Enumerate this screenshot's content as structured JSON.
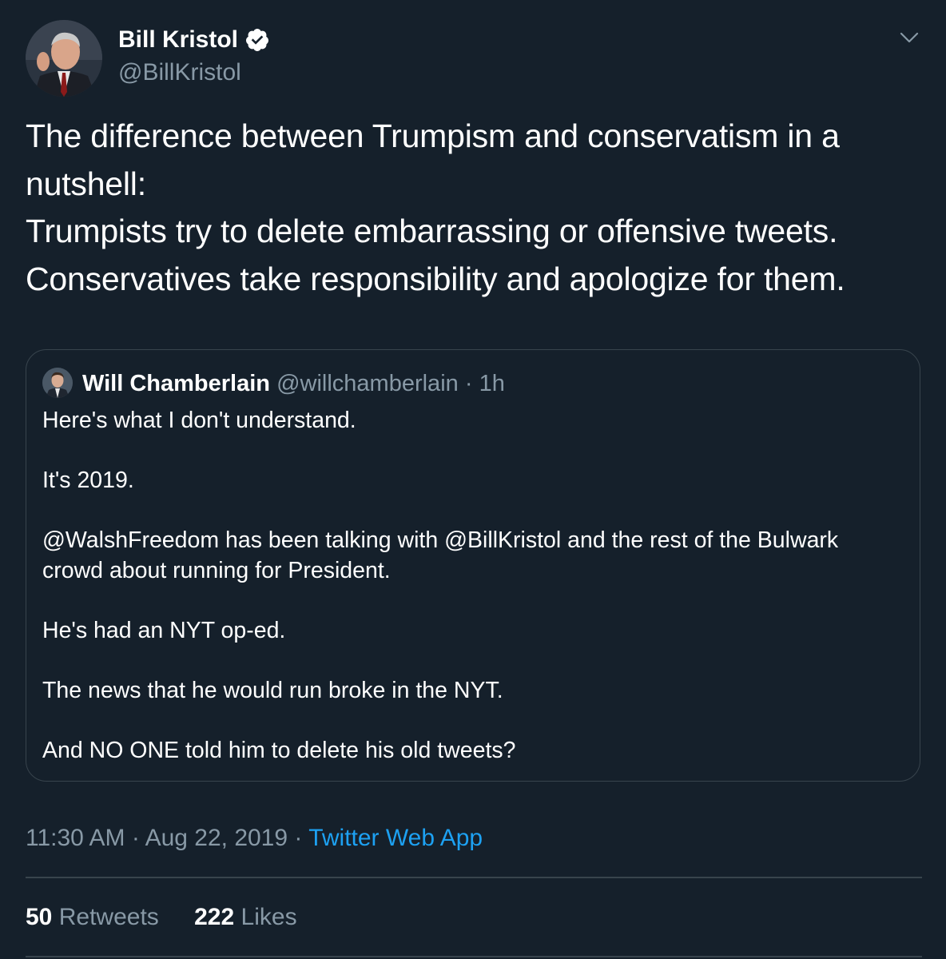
{
  "author": {
    "name": "Bill Kristol",
    "handle": "@BillKristol"
  },
  "tweet": {
    "text": "The difference between Trumpism and conservatism in a\nnutshell:\nTrumpists try to delete embarrassing or offensive tweets.\nConservatives take responsibility and apologize for them."
  },
  "quoted": {
    "name": "Will Chamberlain",
    "handle": "@willchamberlain",
    "separator": "·",
    "time": "1h",
    "text": "Here's what I don't understand.\n\nIt's 2019.\n\n@WalshFreedom has been talking with @BillKristol and the rest of the Bulwark\ncrowd about running for President.\n\nHe's had an NYT op-ed.\n\nThe news that he would run broke in the NYT.\n\nAnd NO ONE told him to delete his old tweets?"
  },
  "meta": {
    "time": "11:30 AM",
    "separator": "·",
    "date": "Aug 22, 2019",
    "source": "Twitter Web App"
  },
  "stats": {
    "retweets_count": "50",
    "retweets_label": "Retweets",
    "likes_count": "222",
    "likes_label": "Likes"
  },
  "icons": {
    "verified": "verified-badge-icon",
    "caret": "chevron-down-icon"
  },
  "colors": {
    "background": "#15202b",
    "secondary_text": "#8899a6",
    "link": "#1da1f2",
    "border": "#38444d"
  }
}
